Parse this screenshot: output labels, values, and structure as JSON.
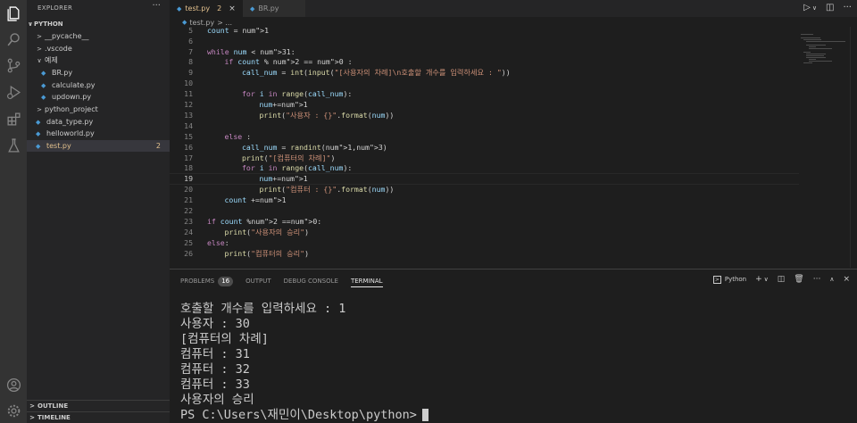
{
  "activity_bar": {
    "top_icons": [
      "files-icon",
      "search-icon",
      "source-control-icon",
      "run-debug-icon",
      "extensions-icon",
      "testing-icon"
    ],
    "bottom_icons": [
      "account-icon",
      "manage-gear-icon"
    ]
  },
  "explorer": {
    "title": "EXPLORER",
    "more": "···",
    "root": "PYTHON",
    "items": [
      {
        "label": "__pycache__",
        "type": "folder",
        "chev": ">"
      },
      {
        "label": ".vscode",
        "type": "folder",
        "chev": ">"
      },
      {
        "label": "예제",
        "type": "folder",
        "chev": "∨"
      },
      {
        "label": "BR.py",
        "type": "file"
      },
      {
        "label": "calculate.py",
        "type": "file"
      },
      {
        "label": "updown.py",
        "type": "file"
      },
      {
        "label": "python_project",
        "type": "folder",
        "chev": ">"
      },
      {
        "label": "data_type.py",
        "type": "file"
      },
      {
        "label": "helloworld.py",
        "type": "file"
      },
      {
        "label": "test.py",
        "type": "file",
        "badge": "2"
      }
    ],
    "outline_label": "OUTLINE",
    "timeline_label": "TIMELINE"
  },
  "tabs": [
    {
      "label": "test.py",
      "badge": "2",
      "active": true
    },
    {
      "label": "BR.py",
      "active": false
    }
  ],
  "breadcrumb": {
    "file": "test.py",
    "rest": "> ..."
  },
  "editor": {
    "current_line": 19,
    "lines": [
      {
        "n": "5",
        "indent": 0,
        "text": "count = 1"
      },
      {
        "n": "6",
        "indent": 0,
        "text": ""
      },
      {
        "n": "7",
        "indent": 0,
        "text": "while num < 31:"
      },
      {
        "n": "8",
        "indent": 1,
        "text": "if count % 2 == 0 :"
      },
      {
        "n": "9",
        "indent": 2,
        "text": "call_num = int(input(\"[사용자의 차례]\\n호출할 개수를 입력하세요 : \"))"
      },
      {
        "n": "10",
        "indent": 0,
        "text": ""
      },
      {
        "n": "11",
        "indent": 2,
        "text": "for i in range(call_num):"
      },
      {
        "n": "12",
        "indent": 3,
        "text": "num+=1"
      },
      {
        "n": "13",
        "indent": 3,
        "text": "print(\"사용자 : {}\".format(num))"
      },
      {
        "n": "14",
        "indent": 0,
        "text": ""
      },
      {
        "n": "15",
        "indent": 1,
        "text": "else :"
      },
      {
        "n": "16",
        "indent": 2,
        "text": "call_num = randint(1,3)"
      },
      {
        "n": "17",
        "indent": 2,
        "text": "print(\"[컴퓨터의 차례]\")"
      },
      {
        "n": "18",
        "indent": 2,
        "text": "for i in range(call_num):"
      },
      {
        "n": "19",
        "indent": 3,
        "text": "num+=1"
      },
      {
        "n": "20",
        "indent": 3,
        "text": "print(\"컴퓨터 : {}\".format(num))"
      },
      {
        "n": "21",
        "indent": 1,
        "text": "count +=1"
      },
      {
        "n": "22",
        "indent": 0,
        "text": ""
      },
      {
        "n": "23",
        "indent": 0,
        "text": "if count %2 ==0:"
      },
      {
        "n": "24",
        "indent": 1,
        "text": "print(\"사용자의 승리\")"
      },
      {
        "n": "25",
        "indent": 0,
        "text": "else:"
      },
      {
        "n": "26",
        "indent": 1,
        "text": "print(\"컴퓨터의 승리\")"
      }
    ]
  },
  "panel": {
    "tabs": [
      {
        "label": "PROBLEMS",
        "badge": "16"
      },
      {
        "label": "OUTPUT"
      },
      {
        "label": "DEBUG CONSOLE"
      },
      {
        "label": "TERMINAL",
        "active": true
      }
    ],
    "terminal_name": "Python",
    "terminal_lines": [
      "호출할 개수를 입력하세요 : 1",
      "사용자 : 30",
      "[컴퓨터의 차례]",
      "컴퓨터 : 31",
      "컴퓨터 : 32",
      "컴퓨터 : 33",
      "사용자의 승리",
      "PS C:\\Users\\재민이\\Desktop\\python>"
    ]
  }
}
